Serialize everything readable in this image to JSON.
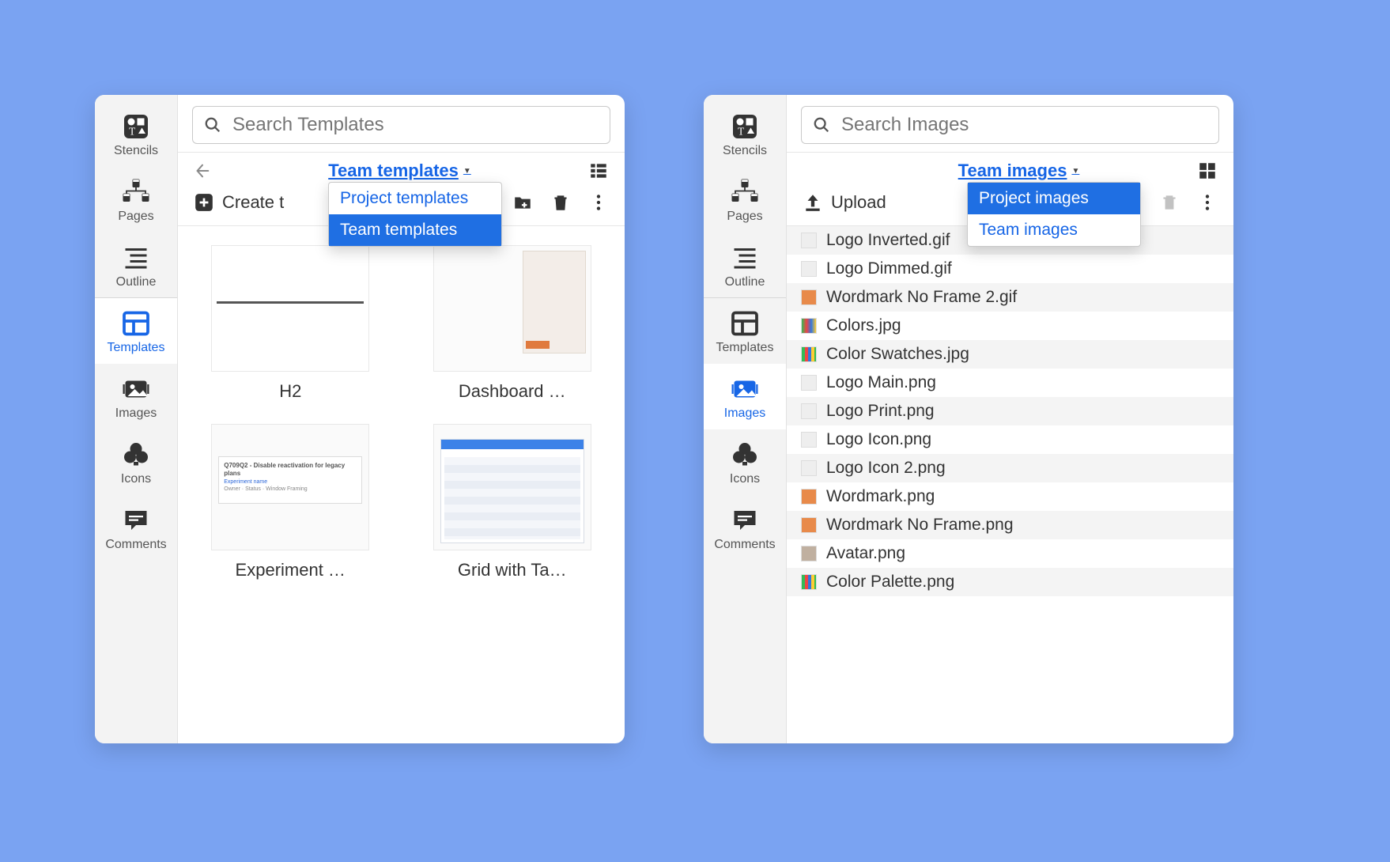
{
  "sidebar": {
    "items": [
      {
        "key": "stencils",
        "label": "Stencils"
      },
      {
        "key": "pages",
        "label": "Pages"
      },
      {
        "key": "outline",
        "label": "Outline"
      },
      {
        "key": "templates",
        "label": "Templates"
      },
      {
        "key": "images",
        "label": "Images"
      },
      {
        "key": "icons",
        "label": "Icons"
      },
      {
        "key": "comments",
        "label": "Comments"
      }
    ]
  },
  "panels": {
    "templates": {
      "search_placeholder": "Search Templates",
      "scope": "Team templates",
      "dropdown": [
        "Project templates",
        "Team templates"
      ],
      "dropdown_selected": "Team templates",
      "create_label": "Create t",
      "cards": [
        {
          "title": "H2"
        },
        {
          "title": "Dashboard …"
        },
        {
          "title": "Experiment …"
        },
        {
          "title": "Grid with Ta…"
        }
      ]
    },
    "images": {
      "search_placeholder": "Search Images",
      "scope": "Team images",
      "dropdown": [
        "Project images",
        "Team images"
      ],
      "dropdown_selected": "Project images",
      "upload_label": "Upload",
      "items": [
        "Logo Inverted.gif",
        "Logo Dimmed.gif",
        "Wordmark No Frame 2.gif",
        "Colors.jpg",
        "Color Swatches.jpg",
        "Logo Main.png",
        "Logo Print.png",
        "Logo Icon.png",
        "Logo Icon 2.png",
        "Wordmark.png",
        "Wordmark No Frame.png",
        "Avatar.png",
        "Color Palette.png"
      ]
    }
  }
}
